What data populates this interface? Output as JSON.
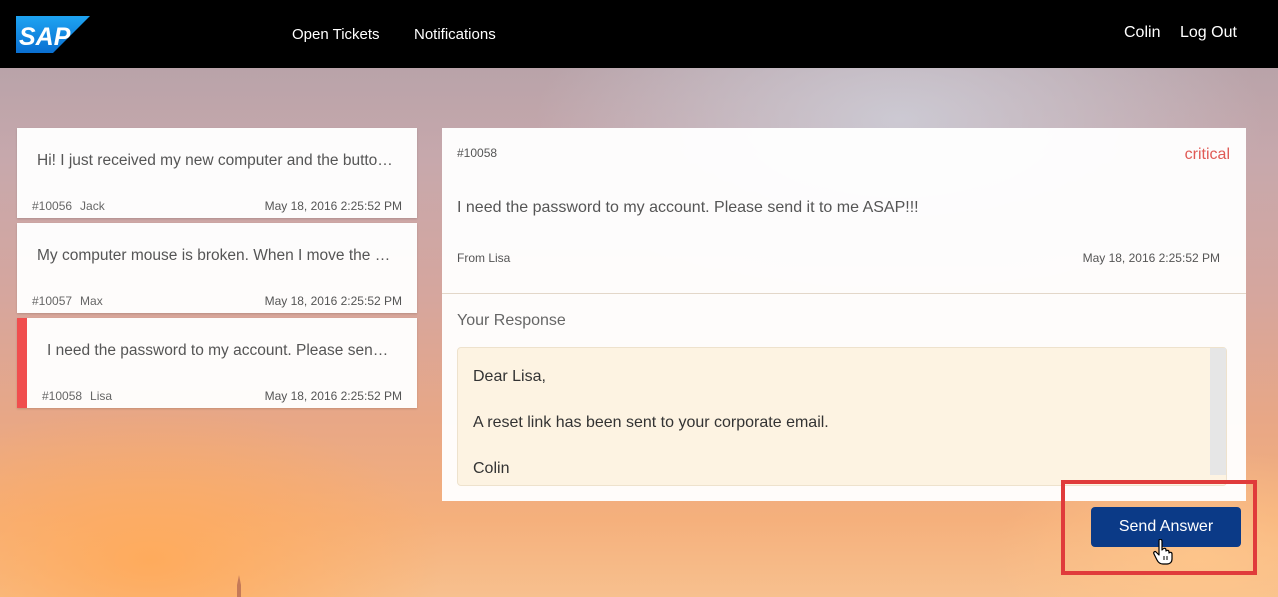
{
  "header": {
    "logo_text": "SAP",
    "nav": {
      "open_tickets": "Open Tickets",
      "notifications": "Notifications"
    },
    "user_name": "Colin",
    "logout_label": "Log Out"
  },
  "tickets": [
    {
      "preview": "Hi! I just received my new computer and the butto…",
      "id": "#10056",
      "name": "Jack",
      "date": "May 18, 2016 2:25:52 PM"
    },
    {
      "preview": "My computer mouse is broken. When I move the …",
      "id": "#10057",
      "name": "Max",
      "date": "May 18, 2016 2:25:52 PM"
    },
    {
      "preview": "I need the password to my account. Please sen…",
      "id": "#10058",
      "name": "Lisa",
      "date": "May 18, 2016 2:25:52 PM",
      "selected": true
    }
  ],
  "detail": {
    "id": "#10058",
    "priority": "critical",
    "message": "I need the password to my account. Please send it to me ASAP!!!",
    "from": "From Lisa",
    "date": "May 18, 2016 2:25:52 PM",
    "response_label": "Your Response",
    "response_lines": [
      "Dear Lisa,",
      "",
      "A reset link has been sent to your corporate email.",
      "",
      "Colin"
    ]
  },
  "actions": {
    "send_label": "Send Answer"
  },
  "colors": {
    "accent": "#0b3a87",
    "critical": "#e05a55",
    "selected_bar": "#f04e4e",
    "highlight": "#e03b3b"
  }
}
